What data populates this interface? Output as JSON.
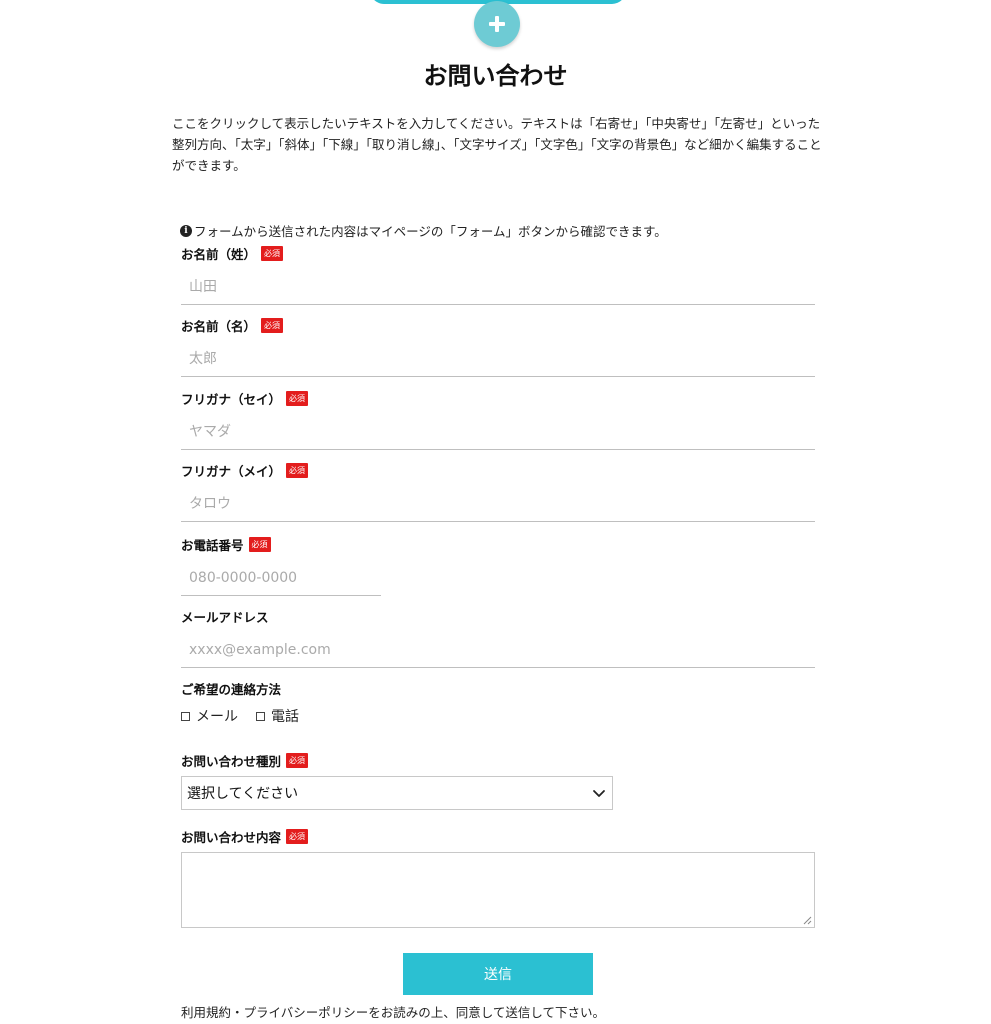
{
  "title": "お問い合わせ",
  "intro": "ここをクリックして表示したいテキストを入力してください。テキストは「右寄せ」「中央寄せ」「左寄せ」といった整列方向、「太字」「斜体」「下線」「取り消し線」、「文字サイズ」「文字色」「文字の背景色」など細かく編集することができます。",
  "notice": "フォームから送信された内容はマイページの「フォーム」ボタンから確認できます。",
  "required_label": "必須",
  "fields": {
    "last_name": {
      "label": "お名前（姓）",
      "placeholder": "山田"
    },
    "first_name": {
      "label": "お名前（名）",
      "placeholder": "太郎"
    },
    "last_name_kana": {
      "label": "フリガナ（セイ）",
      "placeholder": "ヤマダ"
    },
    "first_name_kana": {
      "label": "フリガナ（メイ）",
      "placeholder": "タロウ"
    },
    "phone": {
      "label": "お電話番号",
      "placeholder": "080-0000-0000"
    },
    "email": {
      "label": "メールアドレス",
      "placeholder": "xxxx@example.com"
    },
    "contact_method": {
      "label": "ご希望の連絡方法",
      "options": [
        "メール",
        "電話"
      ]
    },
    "inquiry_type": {
      "label": "お問い合わせ種別",
      "selected": "選択してください"
    },
    "inquiry_content": {
      "label": "お問い合わせ内容"
    }
  },
  "submit_label": "送信",
  "policy": "利用規約・プライバシーポリシーをお読みの上、同意して送信して下さい。",
  "colors": {
    "accent": "#2bc0d2",
    "add_button": "#6ecbd4",
    "required": "#e31d1d"
  },
  "icons": {
    "add": "plus-icon",
    "info": "info-icon",
    "select": "chevron-down-icon"
  }
}
